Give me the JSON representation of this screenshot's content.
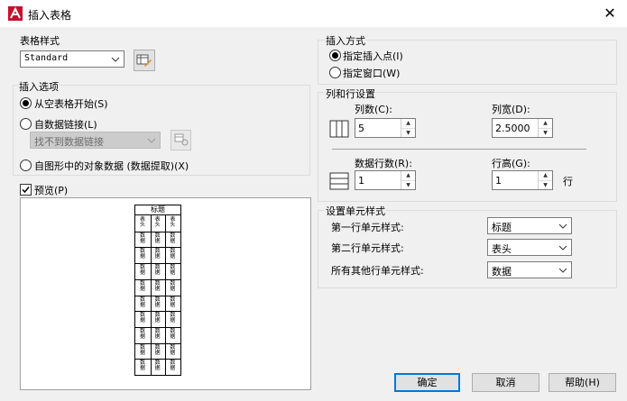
{
  "window": {
    "title": "插入表格",
    "close": "✕"
  },
  "table_style": {
    "label": "表格样式",
    "value": "Standard"
  },
  "insert_options": {
    "label": "插入选项",
    "start_empty": "从空表格开始(S)",
    "from_data_link": "自数据链接(L)",
    "data_link_value": "找不到数据链接",
    "from_drawing_data": "自图形中的对象数据 (数据提取)(X)"
  },
  "preview": {
    "label": "预览(P)",
    "title": "标题",
    "header": "表头",
    "data": "数据"
  },
  "insert_method": {
    "label": "插入方式",
    "specify_point": "指定插入点(I)",
    "specify_window": "指定窗口(W)"
  },
  "columns_rows": {
    "label": "列和行设置",
    "columns_label": "列数(C):",
    "columns_value": "5",
    "column_width_label": "列宽(D):",
    "column_width_value": "2.5000",
    "data_rows_label": "数据行数(R):",
    "data_rows_value": "1",
    "row_height_label": "行高(G):",
    "row_height_value": "1",
    "row_unit": "行"
  },
  "cell_styles": {
    "label": "设置单元样式",
    "first_row_label": "第一行单元样式:",
    "first_row_value": "标题",
    "second_row_label": "第二行单元样式:",
    "second_row_value": "表头",
    "other_rows_label": "所有其他行单元样式:",
    "other_rows_value": "数据"
  },
  "buttons": {
    "ok": "确定",
    "cancel": "取消",
    "help": "帮助(H)"
  }
}
